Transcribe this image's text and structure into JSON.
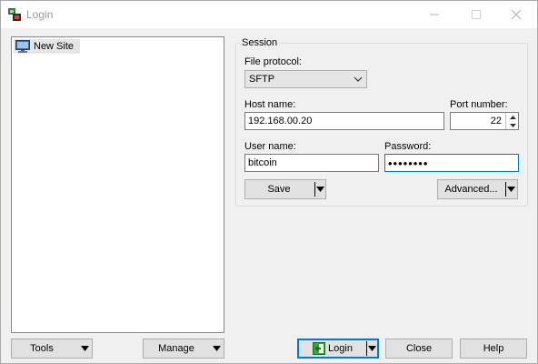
{
  "window": {
    "title": "Login"
  },
  "tree": {
    "items": [
      {
        "label": "New Site",
        "icon": "computer-icon",
        "selected": true
      }
    ]
  },
  "session": {
    "group_label": "Session",
    "file_protocol_label": "File protocol:",
    "file_protocol_value": "SFTP",
    "host_name_label": "Host name:",
    "host_name_value": "192.168.00.20",
    "port_number_label": "Port number:",
    "port_number_value": "22",
    "user_name_label": "User name:",
    "user_name_value": "bitcoin",
    "password_label": "Password:",
    "password_mask": "••••••••",
    "save_label": "Save",
    "advanced_label": "Advanced..."
  },
  "footer": {
    "tools_label": "Tools",
    "manage_label": "Manage",
    "login_label": "Login",
    "close_label": "Close",
    "help_label": "Help"
  },
  "colors": {
    "accent": "#0078d7",
    "window_bg": "#f0f0f0",
    "button_bg": "#e1e1e1"
  }
}
